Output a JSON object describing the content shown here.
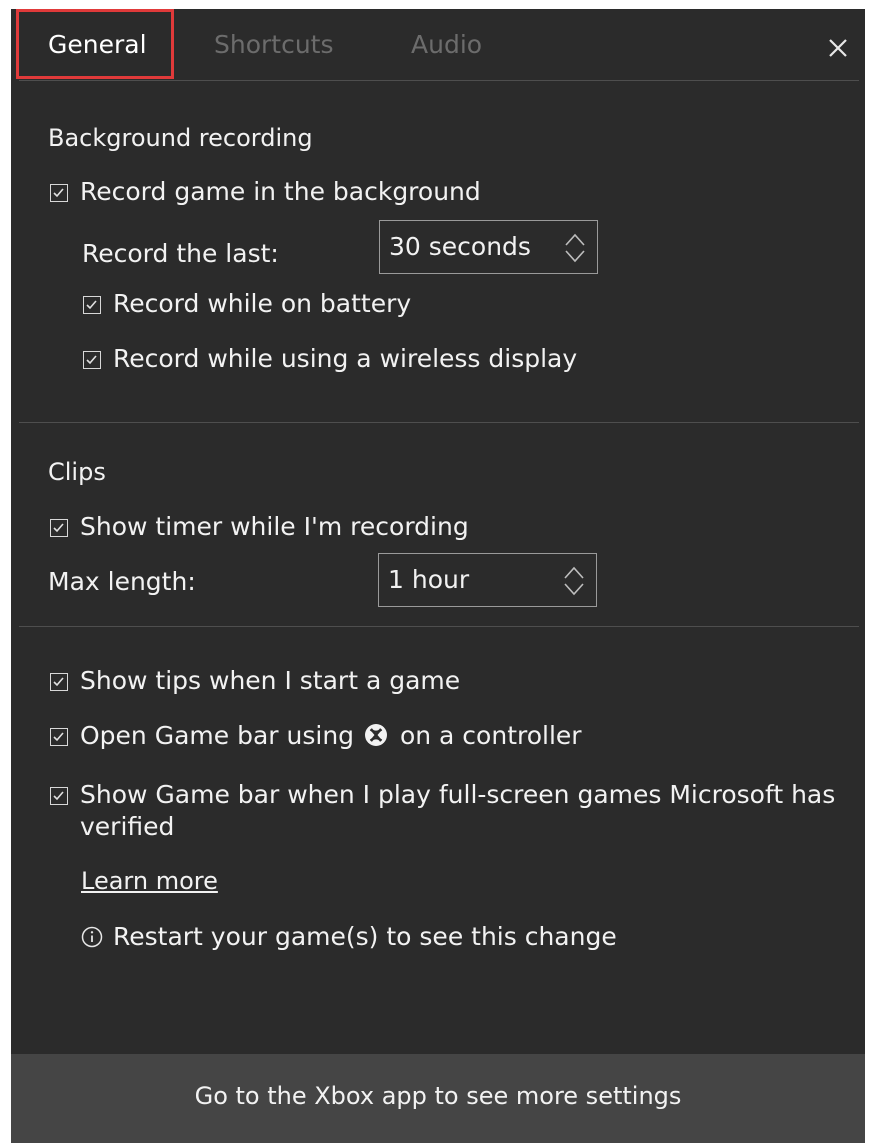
{
  "tabs": [
    {
      "label": "General",
      "active": true
    },
    {
      "label": "Shortcuts",
      "active": false
    },
    {
      "label": "Audio",
      "active": false
    }
  ],
  "close_icon": "close-icon",
  "background_recording": {
    "heading": "Background recording",
    "record_in_background": {
      "label": "Record game in the background",
      "checked": true
    },
    "record_the_last": {
      "label": "Record the last:",
      "value": "30 seconds"
    },
    "record_on_battery": {
      "label": "Record while on battery",
      "checked": true
    },
    "record_wireless_display": {
      "label": "Record while using a wireless display",
      "checked": true
    }
  },
  "clips": {
    "heading": "Clips",
    "show_timer": {
      "label": "Show timer while I'm recording",
      "checked": true
    },
    "max_length": {
      "label": "Max length:",
      "value": "1 hour"
    }
  },
  "general_options": {
    "show_tips": {
      "label": "Show tips when I start a game",
      "checked": true
    },
    "open_game_bar": {
      "label_before": "Open Game bar using",
      "label_after": "on a controller",
      "checked": true
    },
    "show_game_bar_fullscreen": {
      "label": "Show Game bar when I play full-screen games Microsoft has verified",
      "checked": true
    },
    "learn_more": "Learn more",
    "restart_note": "Restart your game(s) to see this change"
  },
  "footer": {
    "label": "Go to the Xbox app to see more settings"
  },
  "colors": {
    "panel_bg": "#2b2b2b",
    "footer_bg": "#454545",
    "highlight": "#e03a3a",
    "inactive_tab": "#6c6c6c"
  }
}
